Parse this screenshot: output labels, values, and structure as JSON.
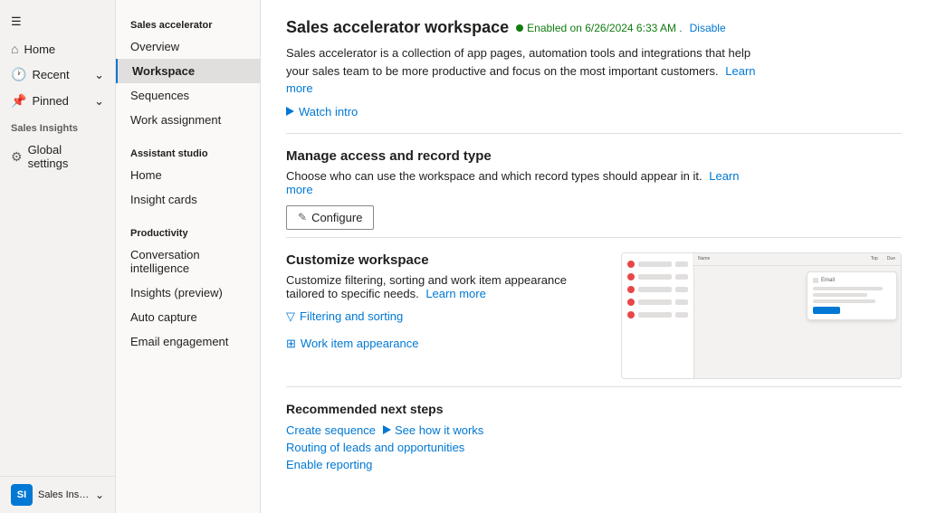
{
  "leftNav": {
    "menuIcon": "☰",
    "items": [
      {
        "id": "home",
        "label": "Home",
        "icon": "⌂"
      },
      {
        "id": "recent",
        "label": "Recent",
        "icon": "🕐",
        "hasChevron": true
      },
      {
        "id": "pinned",
        "label": "Pinned",
        "icon": "📌",
        "hasChevron": true
      }
    ],
    "sectionLabel": "Sales Insights",
    "sectionItems": [
      {
        "id": "global-settings",
        "label": "Global settings",
        "icon": "⚙"
      }
    ],
    "bottom": {
      "badgeText": "SI",
      "label": "Sales Insights sett...",
      "chevron": "⌄"
    }
  },
  "midNav": {
    "sections": [
      {
        "label": "Sales accelerator",
        "items": [
          {
            "id": "overview",
            "label": "Overview",
            "active": false
          },
          {
            "id": "workspace",
            "label": "Workspace",
            "active": true
          },
          {
            "id": "sequences",
            "label": "Sequences",
            "active": false
          },
          {
            "id": "work-assignment",
            "label": "Work assignment",
            "active": false
          }
        ]
      },
      {
        "label": "Assistant studio",
        "items": [
          {
            "id": "home-as",
            "label": "Home",
            "active": false
          },
          {
            "id": "insight-cards",
            "label": "Insight cards",
            "active": false
          }
        ]
      },
      {
        "label": "Productivity",
        "items": [
          {
            "id": "conv-intelligence",
            "label": "Conversation intelligence",
            "active": false
          },
          {
            "id": "insights-preview",
            "label": "Insights (preview)",
            "active": false
          },
          {
            "id": "auto-capture",
            "label": "Auto capture",
            "active": false
          },
          {
            "id": "email-engagement",
            "label": "Email engagement",
            "active": false
          }
        ]
      }
    ]
  },
  "main": {
    "title": "Sales accelerator workspace",
    "enabledText": "Enabled on 6/26/2024 6:33 AM .",
    "disableLabel": "Disable",
    "description": "Sales accelerator is a collection of app pages, automation tools and integrations that help your sales team to be more productive and focus on the most important customers.",
    "learnMoreLink": "Learn more",
    "watchIntroLabel": "Watch intro",
    "sections": [
      {
        "id": "manage-access",
        "title": "Manage access and record type",
        "description": "Choose who can use the workspace and which record types should appear in it.",
        "learnMoreLabel": "Learn more",
        "configureLabel": "Configure"
      },
      {
        "id": "customize-workspace",
        "title": "Customize workspace",
        "description": "Customize filtering, sorting and work item appearance tailored to specific needs.",
        "learnMoreLabel": "Learn more",
        "filteringLabel": "Filtering and sorting",
        "workItemLabel": "Work item appearance"
      }
    ],
    "recommendedSection": {
      "title": "Recommended next steps",
      "links": [
        {
          "id": "create-sequence",
          "label": "Create sequence"
        },
        {
          "id": "see-how",
          "label": "See how it works"
        },
        {
          "id": "routing",
          "label": "Routing of leads and opportunities"
        },
        {
          "id": "enable-reporting",
          "label": "Enable reporting"
        }
      ]
    },
    "preview": {
      "dots": [
        {
          "color": "#e84747"
        },
        {
          "color": "#e84747"
        },
        {
          "color": "#e84747"
        },
        {
          "color": "#e84747"
        },
        {
          "color": "#e84747"
        }
      ],
      "headerTexts": [
        "Name",
        "Top",
        "Due"
      ]
    }
  }
}
